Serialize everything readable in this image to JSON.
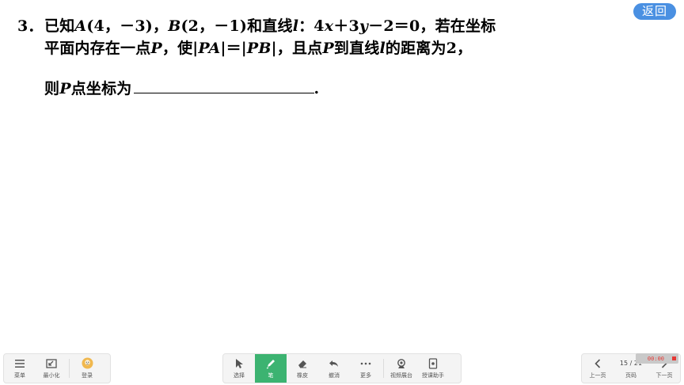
{
  "question": {
    "number": "3．",
    "line1": {
      "p1": "已知",
      "A": "A",
      "p2": "(4，－3)，",
      "B": "B",
      "p3": "(2，－1)和直线",
      "l": "l",
      "p4": "：4",
      "x": "x",
      "p5": "＋3",
      "y": "y",
      "p6": "－2＝0，若在坐标"
    },
    "line2": {
      "p1": "平面内存在一点",
      "P": "P",
      "p2": "，使|",
      "PA": "PA",
      "p3": "|＝|",
      "PB": "PB",
      "p4": "|，且点",
      "P2": "P",
      "p5": "到直线",
      "l": "l",
      "p6": "的距离为2，"
    },
    "line3": {
      "p1": "则",
      "P": "P",
      "p2": "点坐标为",
      "end": "."
    }
  },
  "back_button": "返回",
  "toolbar_left": [
    {
      "label": "菜单",
      "icon": "menu-icon"
    },
    {
      "label": "最小化",
      "icon": "minimize-icon"
    },
    {
      "label": "登录",
      "icon": "avatar-icon"
    }
  ],
  "toolbar_mid": [
    {
      "label": "选择",
      "icon": "cursor-icon"
    },
    {
      "label": "笔",
      "icon": "pen-icon",
      "active": true
    },
    {
      "label": "橡皮",
      "icon": "eraser-icon"
    },
    {
      "label": "撤消",
      "icon": "undo-icon"
    },
    {
      "label": "更多",
      "icon": "more-icon"
    },
    {
      "label": "视频展台",
      "icon": "camera-icon"
    },
    {
      "label": "授课助手",
      "icon": "assistant-icon"
    }
  ],
  "toolbar_right": {
    "prev_label": "上一页",
    "page_label": "页码",
    "page_indicator": "15 / 21",
    "next_label": "下一页"
  },
  "recording": {
    "time": "00:00"
  },
  "colors": {
    "accent_green": "#3cb371",
    "back_blue": "#4a90e2",
    "record_red": "#e53935"
  }
}
